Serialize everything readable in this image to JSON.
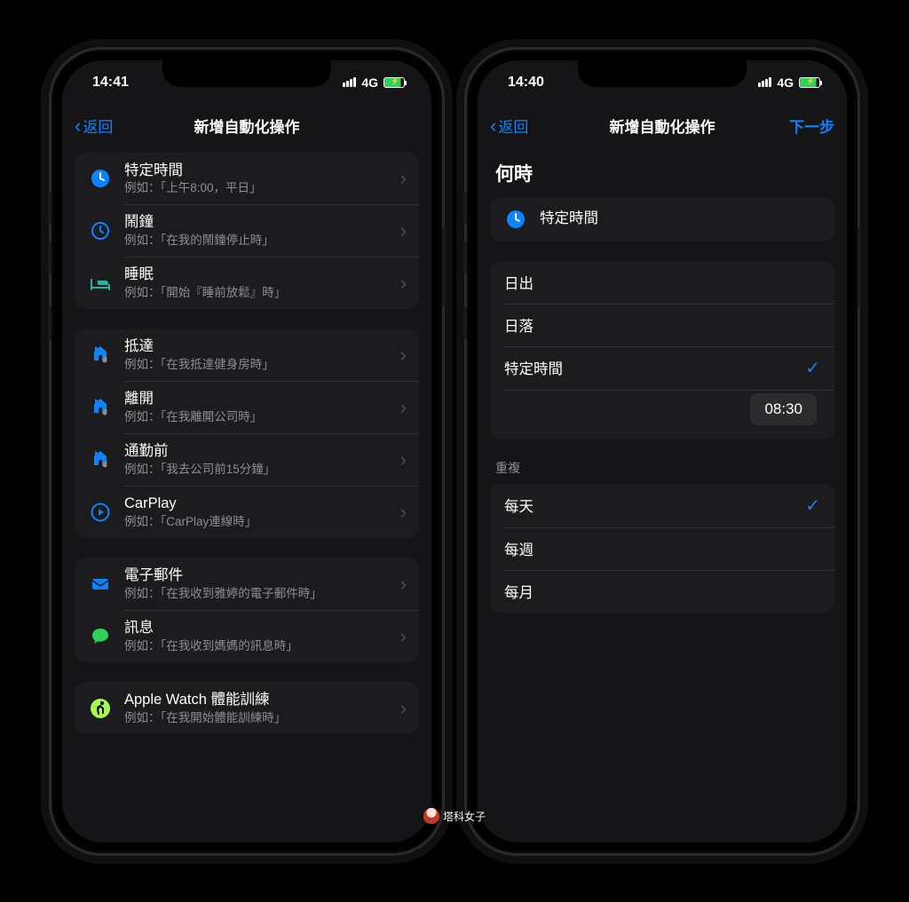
{
  "left": {
    "status": {
      "time": "14:41",
      "network": "4G"
    },
    "nav": {
      "back": "返回",
      "title": "新增自動化操作"
    },
    "groups": [
      [
        {
          "icon": "clock-fill",
          "title": "特定時間",
          "sub": "例如：「上午8:00，平日」"
        },
        {
          "icon": "clock-outline",
          "title": "鬧鐘",
          "sub": "例如：「在我的鬧鐘停止時」"
        },
        {
          "icon": "bed",
          "title": "睡眠",
          "sub": "例如：「開始『睡前放鬆』時」"
        }
      ],
      [
        {
          "icon": "arrive",
          "title": "抵達",
          "sub": "例如：「在我抵達健身房時」"
        },
        {
          "icon": "leave",
          "title": "離開",
          "sub": "例如：「在我離開公司時」"
        },
        {
          "icon": "commute",
          "title": "通勤前",
          "sub": "例如：「我去公司前15分鐘」"
        },
        {
          "icon": "carplay",
          "title": "CarPlay",
          "sub": "例如：「CarPlay連線時」"
        }
      ],
      [
        {
          "icon": "mail",
          "title": "電子郵件",
          "sub": "例如：「在我收到雅婷的電子郵件時」"
        },
        {
          "icon": "message",
          "title": "訊息",
          "sub": "例如：「在我收到媽媽的訊息時」"
        }
      ],
      [
        {
          "icon": "workout",
          "title": "Apple Watch 體能訓練",
          "sub": "例如：「在我開始體能訓練時」"
        }
      ]
    ]
  },
  "right": {
    "status": {
      "time": "14:40",
      "network": "4G"
    },
    "nav": {
      "back": "返回",
      "title": "新增自動化操作",
      "next": "下一步"
    },
    "section_when": "何時",
    "selected_header": {
      "icon": "clock-fill",
      "title": "特定時間"
    },
    "time_options": [
      {
        "label": "日出",
        "checked": false
      },
      {
        "label": "日落",
        "checked": false
      },
      {
        "label": "特定時間",
        "checked": true
      }
    ],
    "time_value": "08:30",
    "repeat_label": "重複",
    "repeat_options": [
      {
        "label": "每天",
        "checked": true
      },
      {
        "label": "每週",
        "checked": false
      },
      {
        "label": "每月",
        "checked": false
      }
    ]
  },
  "watermark": "塔科女子"
}
